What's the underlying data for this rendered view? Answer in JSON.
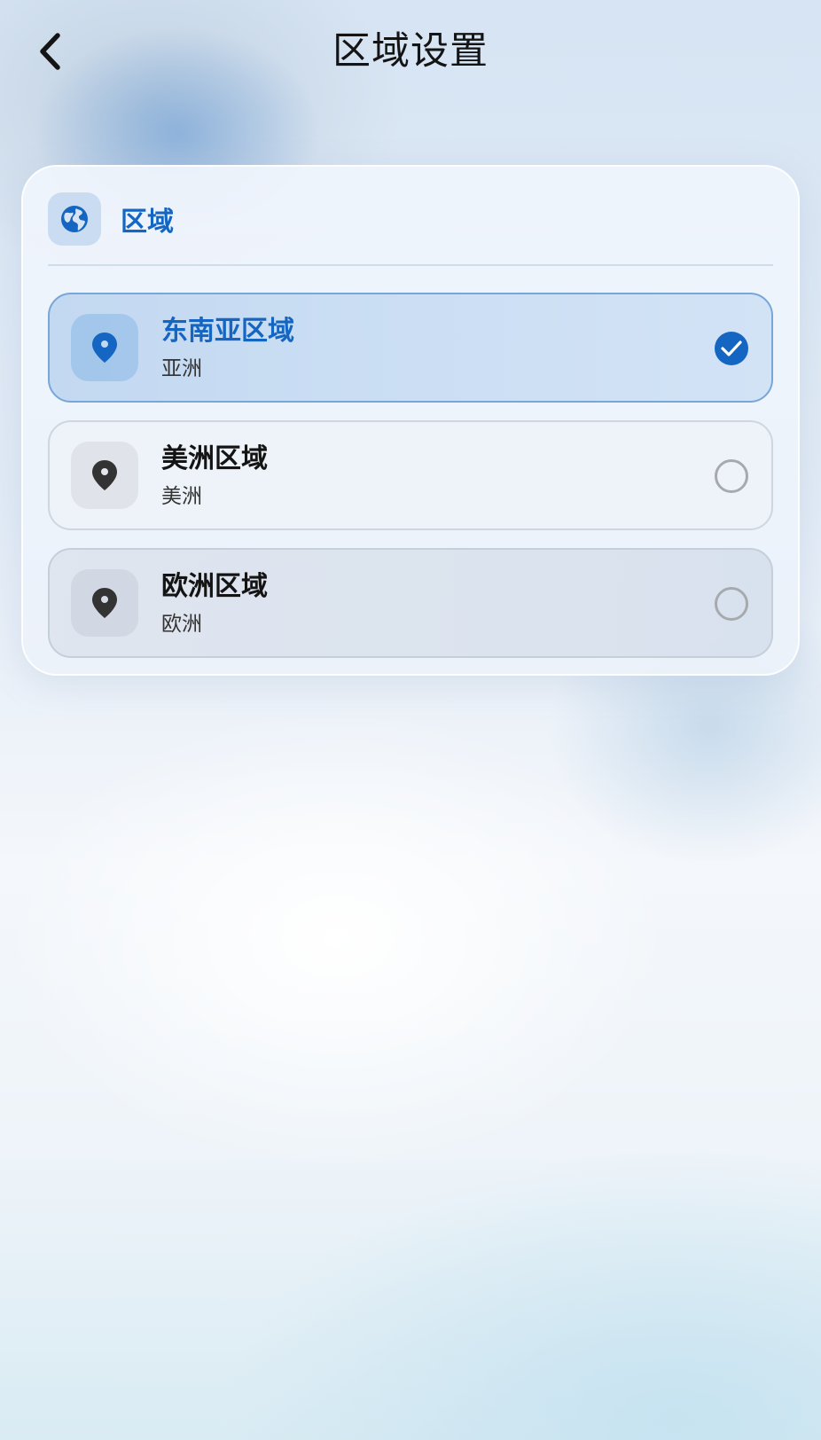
{
  "header": {
    "title": "区域设置",
    "back_icon": "chevron-left-icon"
  },
  "section": {
    "title": "区域",
    "icon": "globe-icon"
  },
  "regions": [
    {
      "name": "东南亚区域",
      "subtitle": "亚洲",
      "selected": true,
      "icon": "map-pin-icon"
    },
    {
      "name": "美洲区域",
      "subtitle": "美洲",
      "selected": false,
      "icon": "map-pin-icon"
    },
    {
      "name": "欧洲区域",
      "subtitle": "欧洲",
      "selected": false,
      "icon": "map-pin-icon"
    }
  ],
  "colors": {
    "accent": "#1466c2",
    "text_primary": "#141414",
    "radio_unchecked": "#a6aaae"
  }
}
